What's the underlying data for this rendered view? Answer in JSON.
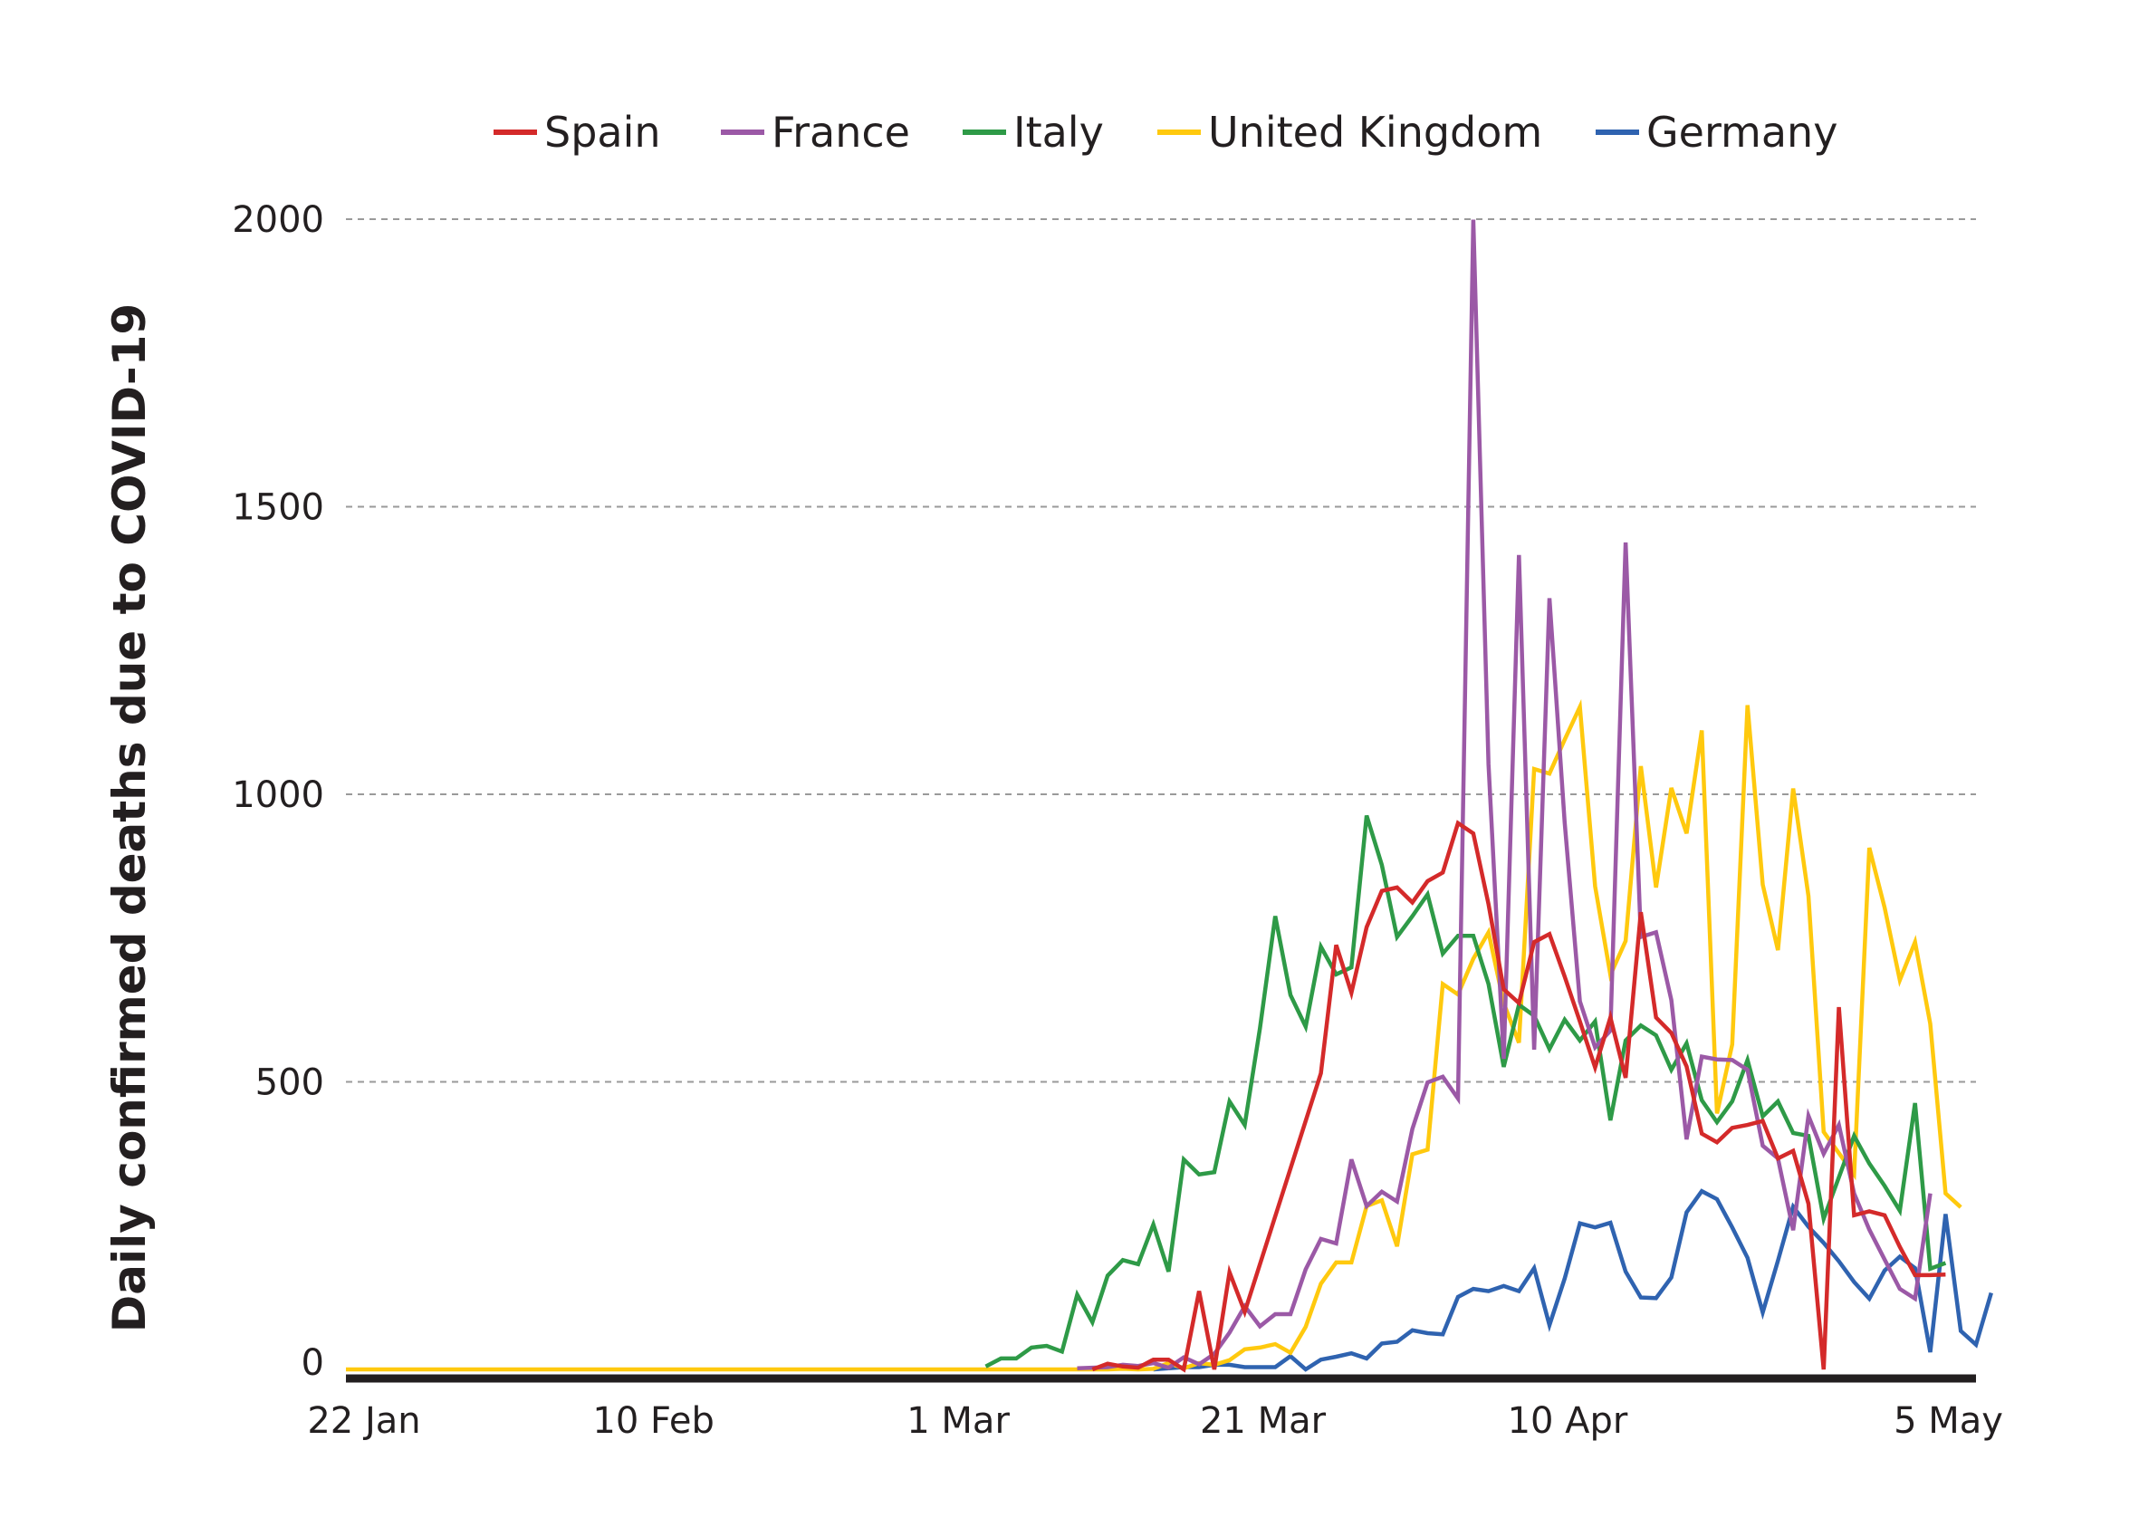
{
  "chart_data": {
    "type": "line",
    "title": "",
    "xlabel": "",
    "ylabel": "Daily confirmed deaths due to COVID-19",
    "ylim": [
      0,
      2000
    ],
    "yticks": [
      0,
      500,
      1000,
      1500,
      2000
    ],
    "ytick_labels": [
      "0",
      "500",
      "1000",
      "1500",
      "2000"
    ],
    "x_start": "22 Jan",
    "x_day_count": 108,
    "xticks": [
      {
        "label": "22 Jan",
        "day": 0
      },
      {
        "label": "10 Feb",
        "day": 19
      },
      {
        "label": "1 Mar",
        "day": 39
      },
      {
        "label": "21 Mar",
        "day": 59
      },
      {
        "label": "10 Apr",
        "day": 79
      },
      {
        "label": "5 May",
        "day": 104
      }
    ],
    "grid": true,
    "grid_style": "dashed horizontal",
    "legend_position": "top",
    "series": [
      {
        "name": "Spain",
        "color": "#d42a2a",
        "start_day": 49,
        "values": [
          0,
          10,
          5,
          3,
          17,
          17,
          0,
          136,
          0,
          169,
          100,
          null,
          null,
          null,
          null,
          515,
          738,
          655,
          769,
          832,
          838,
          812,
          849,
          864,
          950,
          932,
          809,
          661,
          637,
          743,
          757,
          683,
          605,
          525,
          612,
          507,
          795,
          612,
          585,
          527,
          410,
          395,
          420,
          425,
          432,
          367,
          380,
          288,
          0,
          630,
          268,
          275,
          268,
          213,
          164,
          164,
          165
        ]
      },
      {
        "name": "France",
        "color": "#9b59a6",
        "start_day": 48,
        "values": [
          2,
          3,
          4,
          8,
          6,
          11,
          3,
          21,
          9,
          27,
          64,
          110,
          75,
          96,
          96,
          174,
          227,
          219,
          365,
          284,
          309,
          292,
          418,
          499,
          509,
          471,
          1999,
          1052,
          540,
          1416,
          556,
          1341,
          951,
          640,
          560,
          589,
          1438,
          752,
          760,
          642,
          400,
          544,
          539,
          538,
          521,
          389,
          367,
          242,
          441,
          375,
          425,
          306,
          243,
          191,
          140,
          123,
          306
        ]
      },
      {
        "name": "Italy",
        "color": "#2e9a47",
        "start_day": 42,
        "values": [
          5,
          19,
          19,
          38,
          41,
          31,
          130,
          82,
          163,
          190,
          183,
          252,
          170,
          365,
          339,
          343,
          466,
          425,
          593,
          788,
          651,
          596,
          735,
          687,
          699,
          963,
          877,
          752,
          788,
          826,
          723,
          754,
          754,
          670,
          526,
          634,
          615,
          557,
          608,
          572,
          605,
          433,
          572,
          598,
          581,
          521,
          567,
          468,
          430,
          466,
          538,
          440,
          466,
          411,
          406,
          262,
          334,
          406,
          358,
          319,
          276,
          463,
          175,
          185
        ]
      },
      {
        "name": "United Kingdom",
        "color": "#ffc90e",
        "start_day": 0,
        "fill_zero_until_day": 50,
        "values_from_day_50": [
          0,
          1,
          0,
          1,
          11,
          2,
          11,
          8,
          16,
          35,
          38,
          44,
          29,
          74,
          149,
          186,
          186,
          284,
          294,
          214,
          374,
          382,
          670,
          652,
          714,
          760,
          637,
          568,
          1044,
          1036,
          1095,
          1152,
          840,
          686,
          745,
          1049,
          838,
          1011,
          932,
          1111,
          445,
          565,
          1155,
          843,
          729,
          1010,
          823,
          413,
          376,
          339,
          907,
          803,
          677,
          743,
          601,
          306,
          282
        ]
      },
      {
        "name": "Germany",
        "color": "#2f63b0",
        "start_day": 53,
        "values": [
          0,
          2,
          4,
          4,
          8,
          8,
          4,
          4,
          4,
          23,
          0,
          17,
          22,
          28,
          19,
          45,
          48,
          68,
          63,
          61,
          126,
          140,
          136,
          145,
          136,
          176,
          77,
          158,
          254,
          247,
          255,
          170,
          125,
          124,
          160,
          273,
          310,
          296,
          247,
          194,
          99,
          189,
          283,
          248,
          220,
          188,
          152,
          123,
          172,
          196,
          176,
          30,
          270,
          67,
          43,
          133
        ]
      }
    ]
  }
}
